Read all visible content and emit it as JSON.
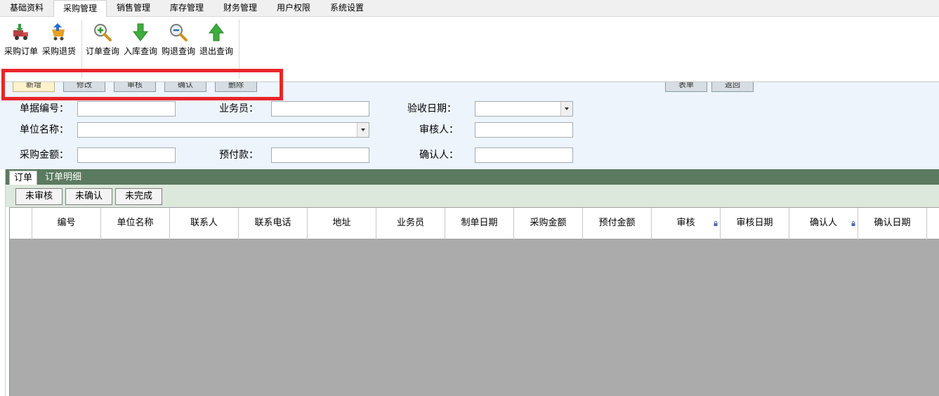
{
  "menu": {
    "tabs": [
      "基础资料",
      "采购管理",
      "销售管理",
      "库存管理",
      "财务管理",
      "用户权限",
      "系统设置"
    ],
    "active_index": 1
  },
  "ribbon": {
    "groups": [
      {
        "buttons": [
          {
            "label": "采购订单",
            "icon": "truck-in-icon"
          },
          {
            "label": "采购退货",
            "icon": "cart-return-icon"
          }
        ]
      },
      {
        "buttons": [
          {
            "label": "订单查询",
            "icon": "zoom-in-icon"
          },
          {
            "label": "入库查询",
            "icon": "arrow-down-icon"
          },
          {
            "label": "购退查询",
            "icon": "zoom-out-icon"
          },
          {
            "label": "退出查询",
            "icon": "arrow-up-icon"
          }
        ]
      }
    ]
  },
  "actions": {
    "left": [
      "新增",
      "修改",
      "审核",
      "确认",
      "删除"
    ],
    "right": [
      "表单",
      "返回"
    ]
  },
  "form": {
    "doc_no_label": "单据编号：",
    "salesman_label": "业务员：",
    "accept_date_label": "验收日期：",
    "company_label": "单位名称：",
    "reviewer_label": "审核人：",
    "amount_label": "采购金额：",
    "prepay_label": "预付款：",
    "confirmer_label": "确认人："
  },
  "grid_tabs": [
    "订单",
    "订单明细"
  ],
  "filters": [
    "未审核",
    "未确认",
    "未完成"
  ],
  "table": {
    "columns": [
      "编号",
      "单位名称",
      "联系人",
      "联系电话",
      "地址",
      "业务员",
      "制单日期",
      "采购金额",
      "预付金额",
      "审核",
      "审核日期",
      "确认人",
      "确认日期"
    ],
    "locked_columns": [
      "审核",
      "确认人"
    ]
  },
  "colors": {
    "annotation": "#e8262a",
    "tab_strip": "#5b7a5f",
    "grid_empty": "#ababab"
  }
}
